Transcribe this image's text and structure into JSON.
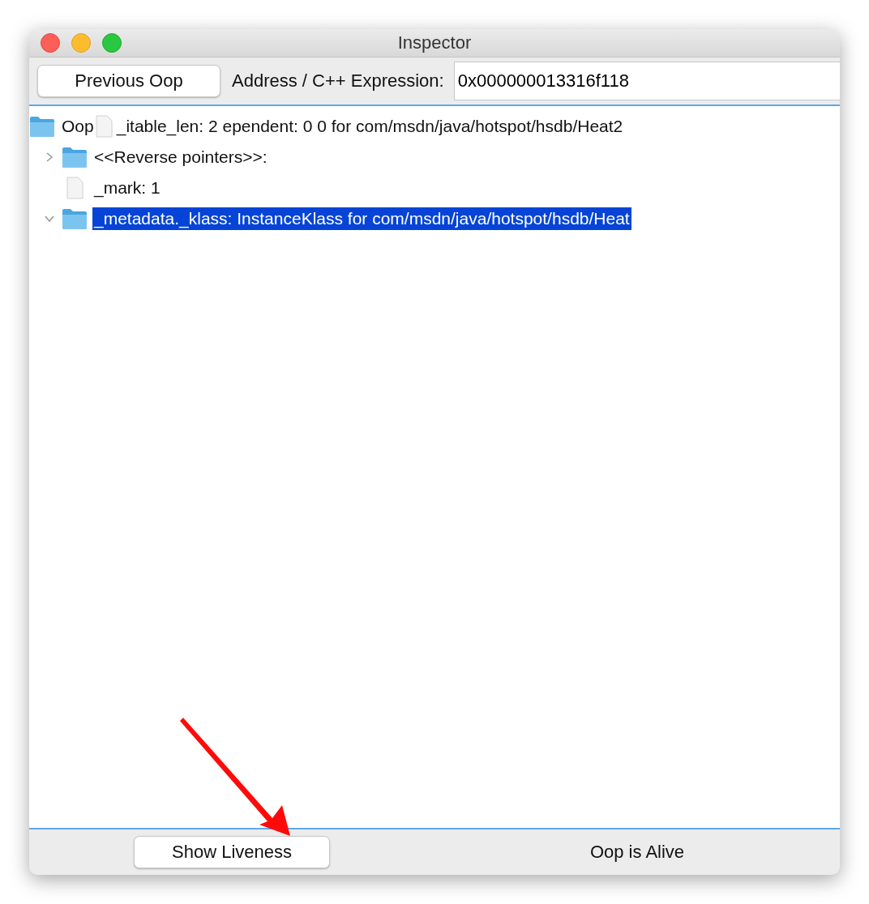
{
  "window": {
    "title": "Inspector"
  },
  "toolbar": {
    "button": "Previous Oop",
    "label": "Address / C++ Expression:",
    "address": {
      "value": "0x000000013316f118"
    }
  },
  "tree": {
    "root": {
      "label_start": "Oop",
      "label_end": "_itable_len: 2 ependent: 0 0 for com/msdn/java/hotspot/hsdb/Heat2",
      "children": [
        {
          "kind": "folder",
          "label": "<<Reverse pointers>>:",
          "expanded": false,
          "selected": false
        },
        {
          "kind": "leaf",
          "label": "_mark: 1",
          "selected": false
        },
        {
          "kind": "folder",
          "label": "_metadata._klass: InstanceKlass for com/msdn/java/hotspot/hsdb/Heat",
          "expanded": true,
          "selected": true
        }
      ]
    }
  },
  "bottom_bar": {
    "button": "Show Liveness",
    "status": "Oop is Alive"
  }
}
